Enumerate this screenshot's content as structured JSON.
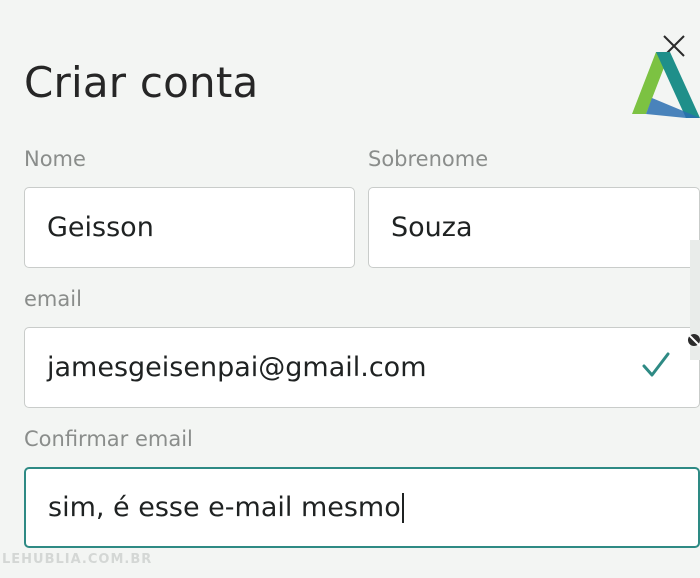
{
  "header": {
    "title": "Criar conta"
  },
  "form": {
    "first_name": {
      "label": "Nome",
      "value": "Geisson"
    },
    "last_name": {
      "label": "Sobrenome",
      "value": "Souza"
    },
    "email": {
      "label": "email",
      "value": "jamesgeisenpai@gmail.com",
      "valid": true
    },
    "confirm_email": {
      "label": "Confirmar email",
      "value": "sim, é esse e-mail mesmo",
      "focused": true
    }
  },
  "colors": {
    "focus_border": "#2e8a84",
    "check": "#2e8a84",
    "logo_teal": "#1f8f8a",
    "logo_green": "#7cc242",
    "logo_blue": "#2a6fb0"
  },
  "icons": {
    "logo": "autodesk-a-logo",
    "valid": "checkmark-icon"
  },
  "watermark": "LEHUBLIA.COM.BR"
}
